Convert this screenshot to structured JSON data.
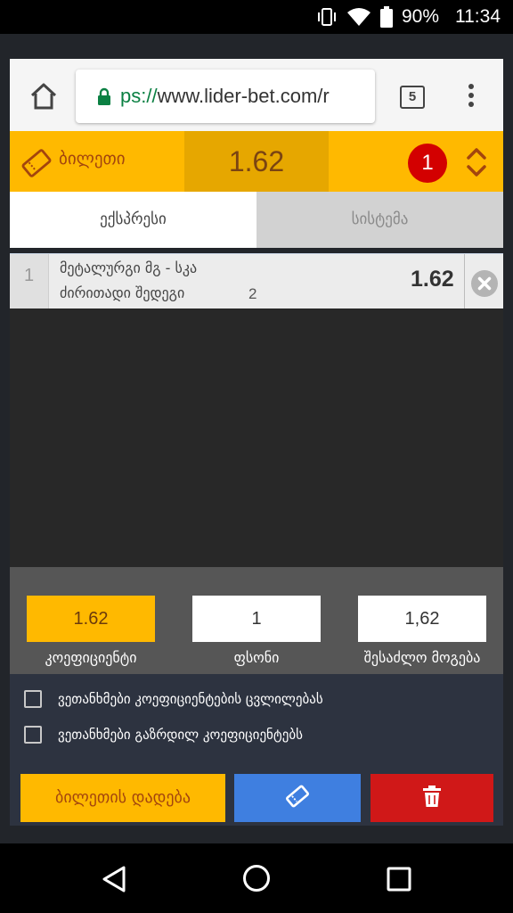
{
  "status_bar": {
    "battery": "90%",
    "time": "11:34",
    "icons": [
      "vibrate-icon",
      "wifi-icon",
      "battery-icon"
    ]
  },
  "browser": {
    "url_scheme": "ps://",
    "url_host": "www.lider-bet.com/r",
    "tab_count": "5"
  },
  "bet_header": {
    "label": "ბილეთი",
    "total_odds": "1.62",
    "selections_count": "1"
  },
  "tabs": {
    "express": "ექსპრესი",
    "system": "სისტემა"
  },
  "selection": {
    "index": "1",
    "match": "მეტალურგი მგ - სკა",
    "market": "ძირითადი შედეგი",
    "outcome": "2",
    "odds": "1.62"
  },
  "totals": {
    "odds_value": "1.62",
    "odds_label": "კოეფიციენტი",
    "stake_value": "1",
    "stake_label": "ფსონი",
    "win_value": "1,62",
    "win_label": "შესაძლო მოგება"
  },
  "options": [
    {
      "label": "ვეთანხმები კოეფიციენტების ცვლილებას",
      "checked": false
    },
    {
      "label": "ვეთანხმები გაზრდილ კოეფიციენტებს",
      "checked": false
    }
  ],
  "actions": {
    "place_bet": "ბილეთის დადება"
  },
  "colors": {
    "accent": "#ffb900",
    "accent_dark": "#e6a700",
    "badge": "#d30000",
    "save_button": "#3f7fe0",
    "delete_button": "#d01818"
  }
}
